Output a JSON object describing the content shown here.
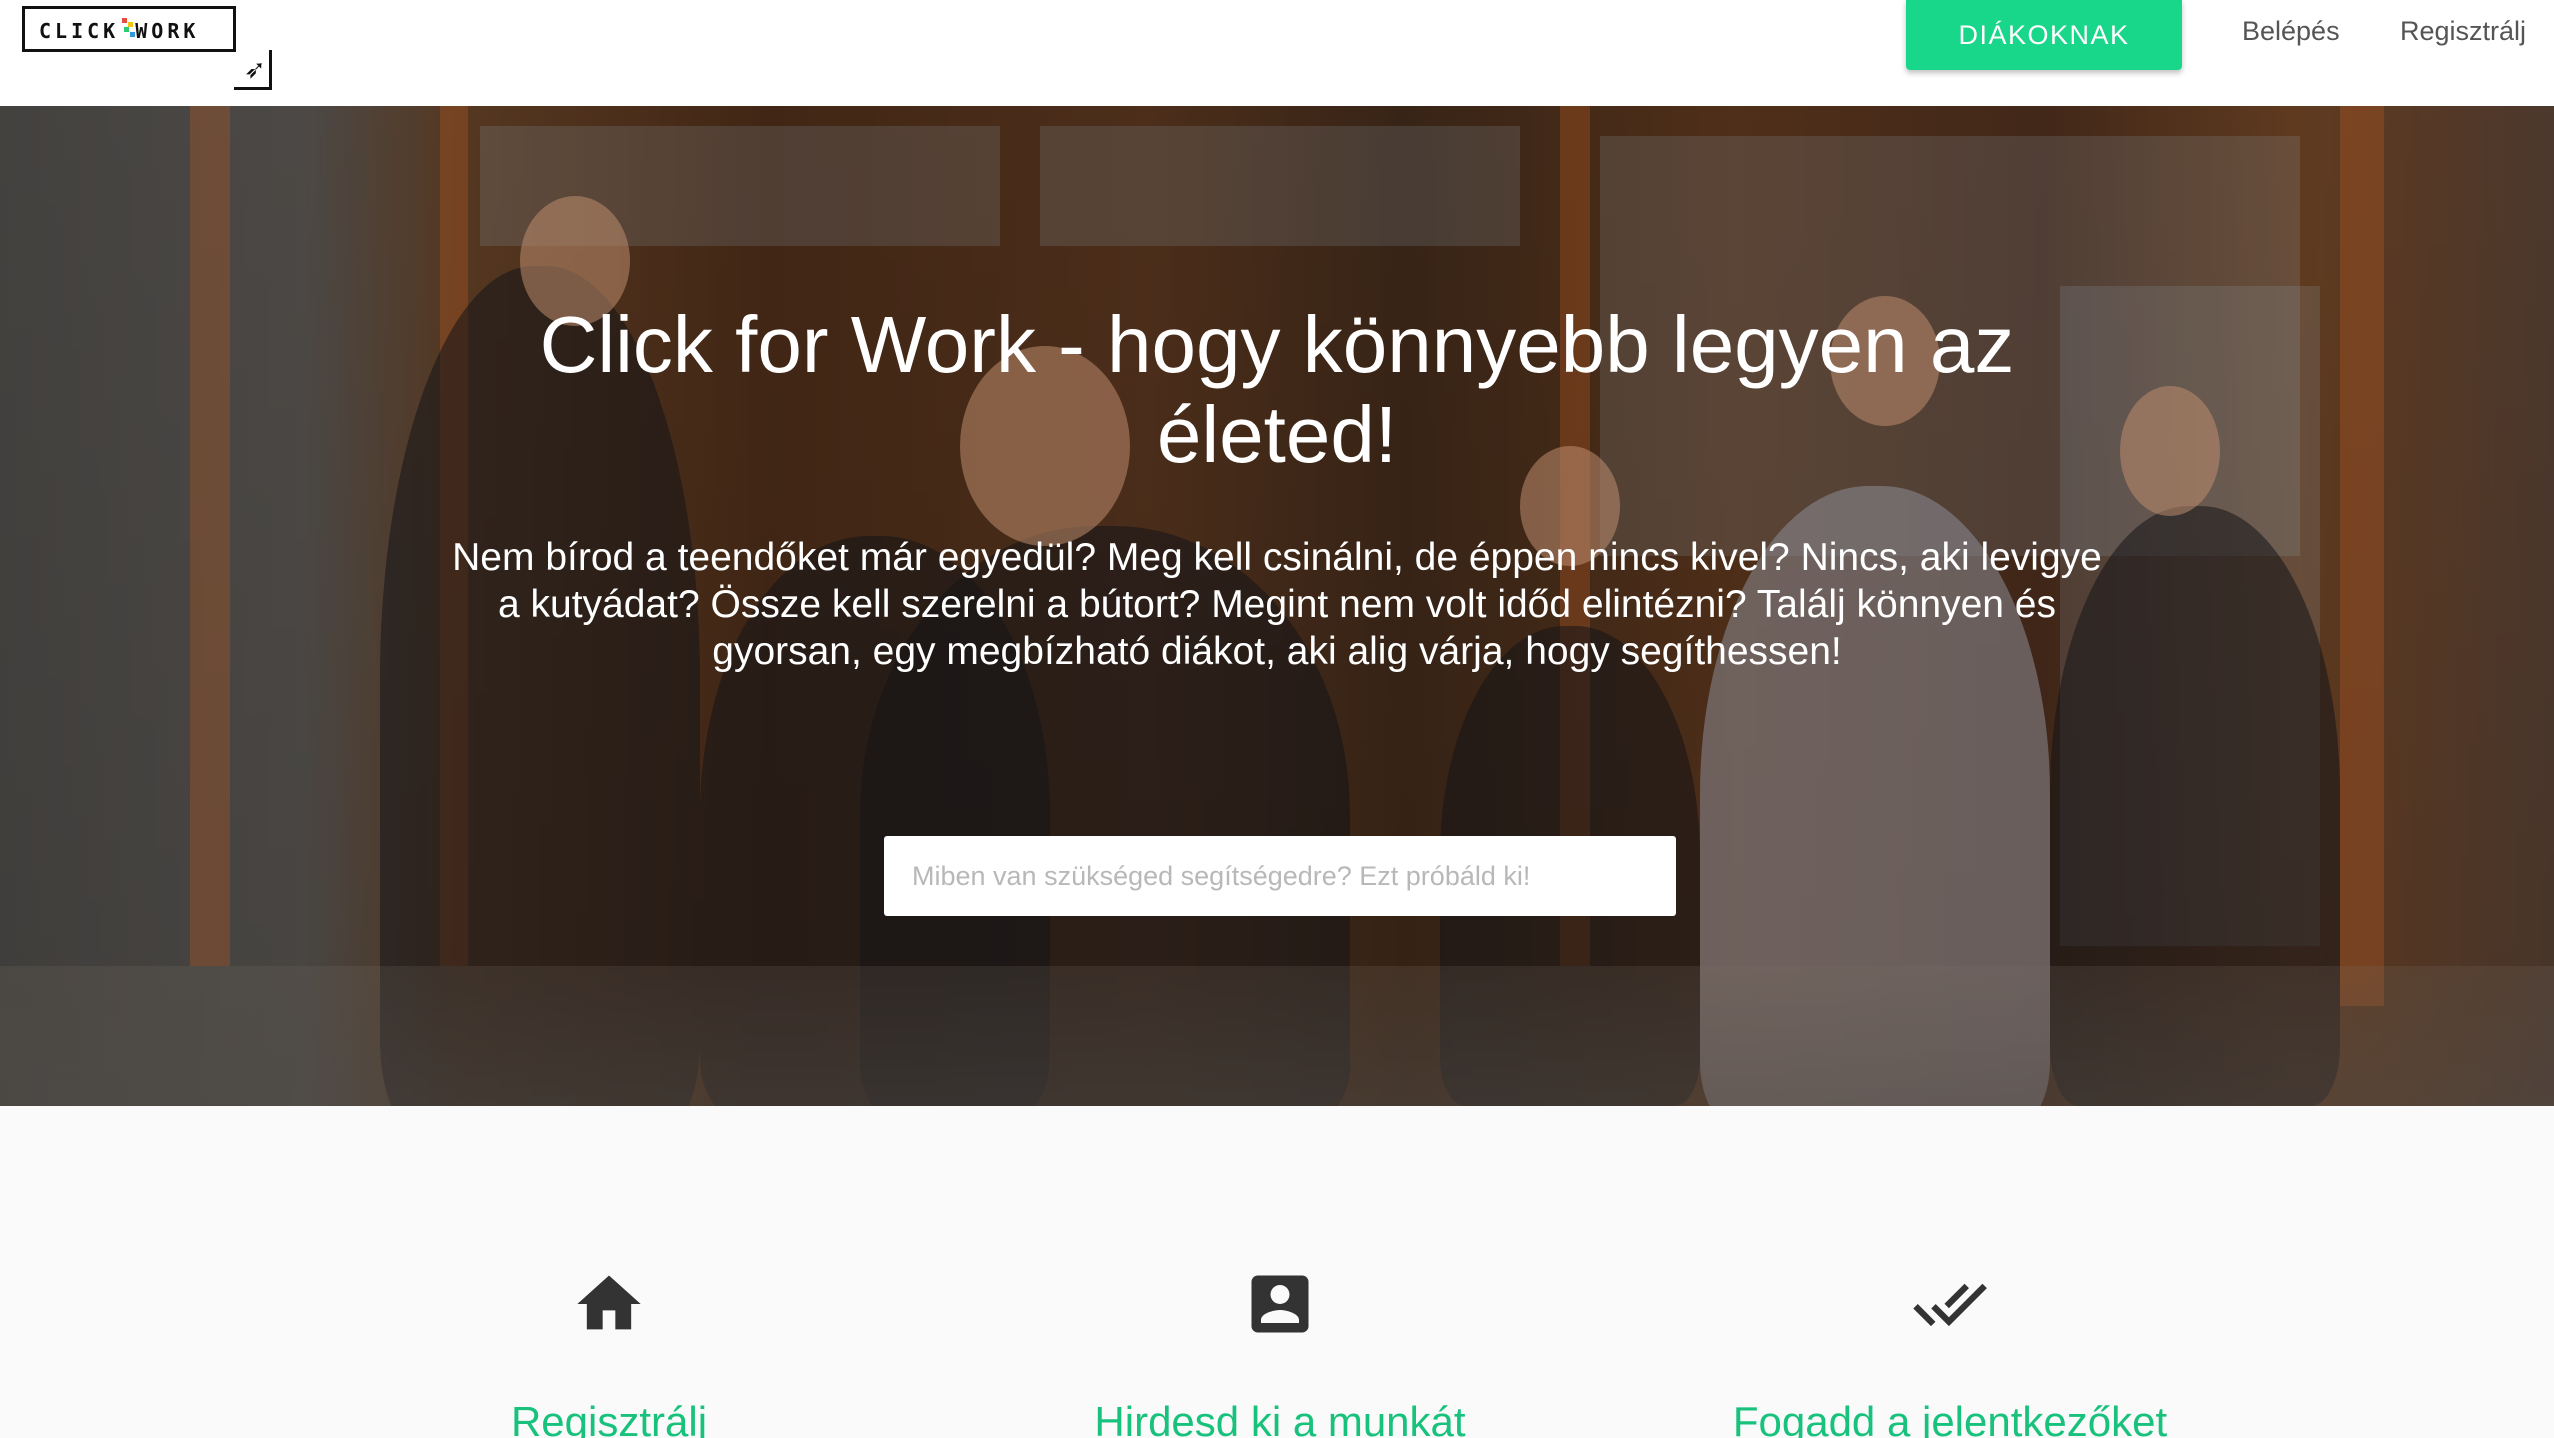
{
  "header": {
    "logo_text": "CLICK WORK",
    "students_button": "DIÁKOKNAK",
    "login_link": "Belépés",
    "register_link": "Regisztrálj"
  },
  "hero": {
    "title": "Click for Work - hogy könnyebb legyen az életed!",
    "description": "Nem bírod a teendőket már egyedül? Meg kell csinálni, de éppen nincs kivel? Nincs, aki levigye a kutyádat? Össze kell szerelni a bútort? Megint nem volt időd elintézni? Találj könnyen és gyorsan, egy megbízható diákot, aki alig várja, hogy segíthessen!",
    "search_placeholder": "Miben van szükséged segítségedre? Ezt próbáld ki!",
    "search_value": ""
  },
  "features": [
    {
      "icon": "home-icon",
      "title": "Regisztrálj"
    },
    {
      "icon": "contact-card-icon",
      "title": "Hirdesd ki a munkát"
    },
    {
      "icon": "double-check-icon",
      "title": "Fogadd a jelentkezőket"
    }
  ],
  "colors": {
    "accent": "#18d68a",
    "feature_title": "#18c27c",
    "header_bg": "#ffffff",
    "section_bg": "#fafafa"
  }
}
